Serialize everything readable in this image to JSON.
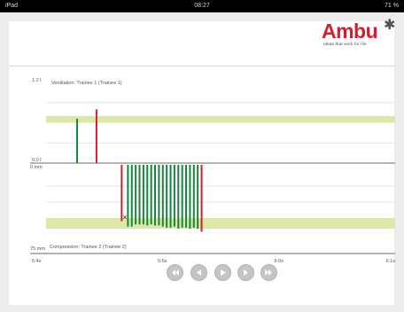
{
  "status_bar": {
    "carrier": "iPad",
    "time": "08:27",
    "battery": "71 %"
  },
  "logo": {
    "word": "Ambu",
    "tagline": "Ideas that work for life"
  },
  "colors": {
    "ok": "#16843c",
    "error": "#cf2030",
    "target_band": "#dde8a8",
    "accent": "#cf2030"
  },
  "chart_data": [
    {
      "type": "bar",
      "title": "Ventilation: Trainee 1 (Trainee 1)",
      "ylabel_top": "1.2 l",
      "ylabel_bottom": "0.0 l",
      "ylim": [
        0,
        1.2
      ],
      "target_band": [
        0.6,
        0.7
      ],
      "x": [
        0.8,
        1.3
      ],
      "values": [
        0.66,
        0.8
      ],
      "status": [
        "ok",
        "error"
      ],
      "grid": true
    },
    {
      "type": "bar",
      "title": "Compression: Trainee 2 (Trainee 2)",
      "ylabel_top": "0 mm",
      "ylabel_bottom": "75 mm",
      "ylim": [
        0,
        75
      ],
      "inverted": true,
      "target_band": [
        50,
        60
      ],
      "x": [
        1.95,
        2.03,
        2.11,
        2.21,
        2.31,
        2.41,
        2.51,
        2.61,
        2.71,
        2.81,
        2.91,
        3.01,
        3.11,
        3.21,
        3.31,
        3.41,
        3.51,
        3.61,
        3.71,
        3.81,
        3.91,
        4.01
      ],
      "values": [
        53,
        0,
        58,
        58,
        56,
        56,
        56,
        57,
        56,
        57,
        57,
        58,
        59,
        59,
        58,
        60,
        59,
        59,
        60,
        59,
        60,
        63
      ],
      "status": [
        "error",
        "marker",
        "ok",
        "ok",
        "ok",
        "ok",
        "ok",
        "ok",
        "ok",
        "ok",
        "ok",
        "ok",
        "ok",
        "ok",
        "ok",
        "ok",
        "ok",
        "ok",
        "ok",
        "ok",
        "ok",
        "error"
      ],
      "marker": {
        "x": 2.03,
        "y": 49,
        "symbol": "×"
      },
      "grid": true
    }
  ],
  "time_axis": {
    "ticks": [
      {
        "t": 0,
        "label": "5:4s"
      },
      {
        "t": 3,
        "label": "5:5s"
      },
      {
        "t": 6,
        "label": "6:0s"
      },
      {
        "t": 9,
        "label": "6:1s"
      }
    ],
    "range": [
      0,
      9
    ]
  },
  "controls": [
    {
      "icon": "skip-back-icon",
      "label": "Skip back"
    },
    {
      "icon": "step-back-icon",
      "label": "Step back"
    },
    {
      "icon": "play-icon",
      "label": "Play"
    },
    {
      "icon": "step-forward-icon",
      "label": "Step forward"
    },
    {
      "icon": "skip-forward-icon",
      "label": "Skip forward"
    }
  ]
}
